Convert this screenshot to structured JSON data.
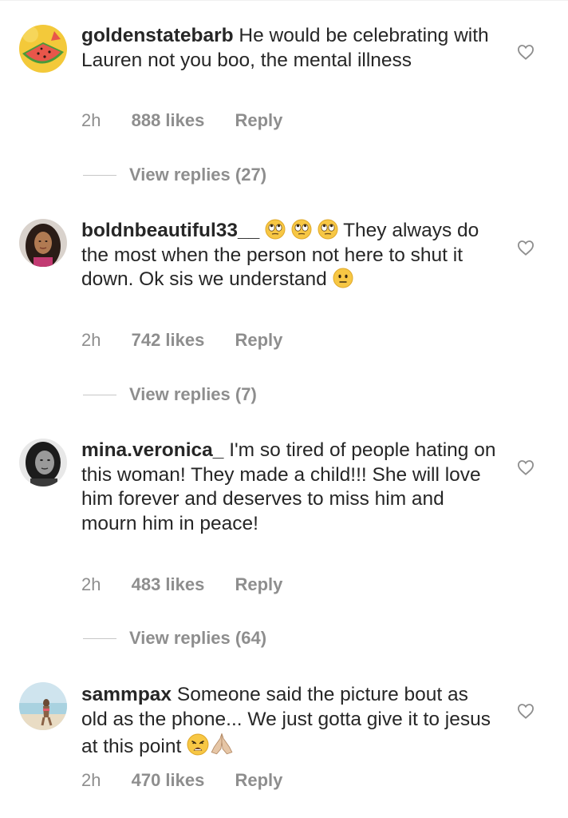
{
  "colors": {
    "text": "#262626",
    "secondary": "#8e8e8e",
    "divider": "#c7c7c7"
  },
  "comments": [
    {
      "username": "goldenstatebarb",
      "text": " He would be celebrating with Lauren not you boo, the mental illness",
      "time": "2h",
      "likes": "888 likes",
      "reply": "Reply",
      "view_replies": "View replies (27)",
      "avatar_icon": "watermelon-avatar",
      "like_icon": "heart-outline-icon"
    },
    {
      "username": "boldnbeautiful33__",
      "text_before_emoji": " ",
      "emojis_inline": [
        "eye-roll-emoji",
        "eye-roll-emoji",
        "eye-roll-emoji"
      ],
      "text": " They always do the most when the person not here to shut it down. Ok sis we understand ",
      "trailing_emoji": "neutral-face-emoji",
      "time": "2h",
      "likes": "742 likes",
      "reply": "Reply",
      "view_replies": "View replies (7)",
      "avatar_icon": "woman-portrait-avatar",
      "like_icon": "heart-outline-icon"
    },
    {
      "username": "mina.veronica_",
      "text": " I'm so tired of people hating on this woman! They made a child!!! She will love him forever and deserves to miss him and mourn him in peace!",
      "time": "2h",
      "likes": "483 likes",
      "reply": "Reply",
      "view_replies": "View replies (64)",
      "avatar_icon": "bw-portrait-avatar",
      "like_icon": "heart-outline-icon"
    },
    {
      "username": "sammpax",
      "text": " Someone said the picture bout as old as the phone... We just gotta give it to jesus at this point ",
      "trailing_emojis": [
        "weary-face-emoji",
        "praying-hands-emoji"
      ],
      "time": "2h",
      "likes": "470 likes",
      "reply": "Reply",
      "avatar_icon": "beach-avatar",
      "like_icon": "heart-outline-icon"
    }
  ]
}
